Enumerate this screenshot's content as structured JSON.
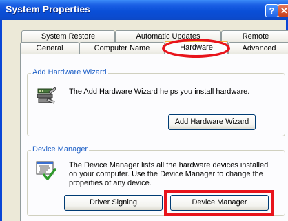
{
  "window": {
    "title": "System Properties",
    "help_glyph": "?",
    "close_glyph": "✕"
  },
  "tabs": {
    "back_row": [
      "System Restore",
      "Automatic Updates",
      "Remote"
    ],
    "front_row": [
      "General",
      "Computer Name",
      "Hardware",
      "Advanced"
    ],
    "active": "Hardware"
  },
  "hardware_wizard": {
    "legend": "Add Hardware Wizard",
    "description": "The Add Hardware Wizard helps you install hardware.",
    "button_label": "Add Hardware Wizard",
    "icon": "hardware-wizard-icon"
  },
  "device_manager": {
    "legend": "Device Manager",
    "description_lines": [
      "The Device Manager lists all the hardware devices installed",
      "on your computer. Use the Device Manager to change the",
      "properties of any device."
    ],
    "driver_signing_label": "Driver Signing",
    "device_manager_label": "Device Manager",
    "icon": "device-manager-icon"
  },
  "annotations": {
    "highlight_color": "#e8141c",
    "circled": "Hardware",
    "boxed": "Device Manager"
  },
  "colors": {
    "titlebar_blue": "#0a4fd8",
    "dialog_face": "#ece9d8",
    "legend_blue": "#1d5fc6"
  }
}
